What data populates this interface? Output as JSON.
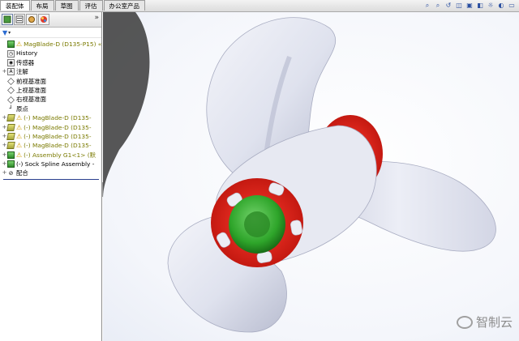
{
  "tabs": [
    {
      "label": "装配体",
      "active": true
    },
    {
      "label": "布局",
      "active": false
    },
    {
      "label": "草图",
      "active": false
    },
    {
      "label": "评估",
      "active": false
    },
    {
      "label": "办公室产品",
      "active": false
    }
  ],
  "view_toolbar_icons": [
    "zoom-to-fit-icon",
    "zoom-area-icon",
    "previous-view-icon",
    "section-view-icon",
    "view-orientation-icon",
    "display-style-icon",
    "hide-show-icon",
    "edit-appearance-icon",
    "scene-icon"
  ],
  "panel": {
    "tab_icons": [
      "feature-manager-icon",
      "property-manager-icon",
      "configuration-manager-icon",
      "display-manager-icon"
    ],
    "expand_glyph": "»",
    "tree": [
      {
        "label": "MagBlade-D (D135-P15) «",
        "icon": "assembly-doc-icon",
        "warn": true,
        "style": "yellow",
        "exp": ""
      },
      {
        "label": "History",
        "icon": "history-icon",
        "warn": false,
        "style": "black",
        "exp": ""
      },
      {
        "label": "传感器",
        "icon": "sensor-icon",
        "warn": false,
        "style": "black",
        "exp": ""
      },
      {
        "label": "注解",
        "icon": "annotations-icon",
        "warn": false,
        "style": "black",
        "exp": "+"
      },
      {
        "label": "前视基准面",
        "icon": "plane-icon",
        "warn": false,
        "style": "black",
        "exp": ""
      },
      {
        "label": "上视基准面",
        "icon": "plane-icon",
        "warn": false,
        "style": "black",
        "exp": ""
      },
      {
        "label": "右视基准面",
        "icon": "plane-icon",
        "warn": false,
        "style": "black",
        "exp": ""
      },
      {
        "label": "原点",
        "icon": "origin-icon",
        "warn": false,
        "style": "black",
        "exp": ""
      },
      {
        "label": "(-) MagBlade-D (D135-",
        "icon": "part-icon",
        "warn": true,
        "style": "yellow",
        "exp": "+"
      },
      {
        "label": "(-) MagBlade-D (D135-",
        "icon": "part-icon",
        "warn": true,
        "style": "yellow",
        "exp": "+"
      },
      {
        "label": "(-) MagBlade-D (D135-",
        "icon": "part-icon",
        "warn": true,
        "style": "yellow",
        "exp": "+"
      },
      {
        "label": "(-) MagBlade-D (D135-",
        "icon": "part-icon",
        "warn": true,
        "style": "yellow",
        "exp": "+"
      },
      {
        "label": "(-) Assembly G1<1> (默",
        "icon": "subassembly-icon",
        "warn": true,
        "style": "yellow",
        "exp": "+"
      },
      {
        "label": "(-) Sock Spline Assembly -",
        "icon": "subassembly-icon",
        "warn": false,
        "style": "black",
        "exp": "+"
      },
      {
        "label": "配合",
        "icon": "mates-icon",
        "warn": false,
        "style": "black",
        "exp": "+"
      }
    ]
  },
  "watermark": {
    "text": "智制云"
  },
  "colors": {
    "hub_red": "#e21b12",
    "shaft_green": "#2ea52a",
    "blade_body": "#dde0ec",
    "panel_border": "#8e8e8e"
  }
}
